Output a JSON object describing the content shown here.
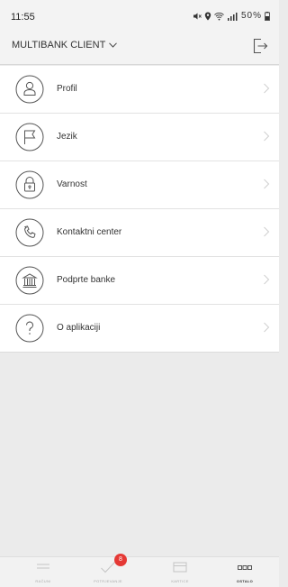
{
  "status_bar": {
    "time": "11:55",
    "battery": "50%",
    "icons": [
      "mute-icon",
      "location-icon",
      "wifi-icon",
      "signal-icon",
      "battery-icon"
    ]
  },
  "header": {
    "client_label": "MULTIBANK CLIENT",
    "dropdown_icon": "chevron-down-icon",
    "logout_icon": "logout-icon"
  },
  "menu": {
    "items": [
      {
        "label": "Profil",
        "icon": "person-icon"
      },
      {
        "label": "Jezik",
        "icon": "flag-icon"
      },
      {
        "label": "Varnost",
        "icon": "lock-icon"
      },
      {
        "label": "Kontaktni center",
        "icon": "phone-icon"
      },
      {
        "label": "Podprte banke",
        "icon": "bank-icon"
      },
      {
        "label": "O aplikaciji",
        "icon": "question-icon"
      }
    ]
  },
  "bottom_nav": {
    "items": [
      {
        "label": "RAČUNI",
        "icon": "list-icon",
        "active": false
      },
      {
        "label": "POTRJEVANJE",
        "icon": "check-icon",
        "active": false,
        "badge": "8"
      },
      {
        "label": "KARTICE",
        "icon": "card-icon",
        "active": false
      },
      {
        "label": "OSTALO",
        "icon": "more-icon",
        "active": true
      }
    ]
  },
  "colors": {
    "background": "#ebebeb",
    "list_background": "#ffffff",
    "badge": "#e53935",
    "text": "#333333"
  }
}
